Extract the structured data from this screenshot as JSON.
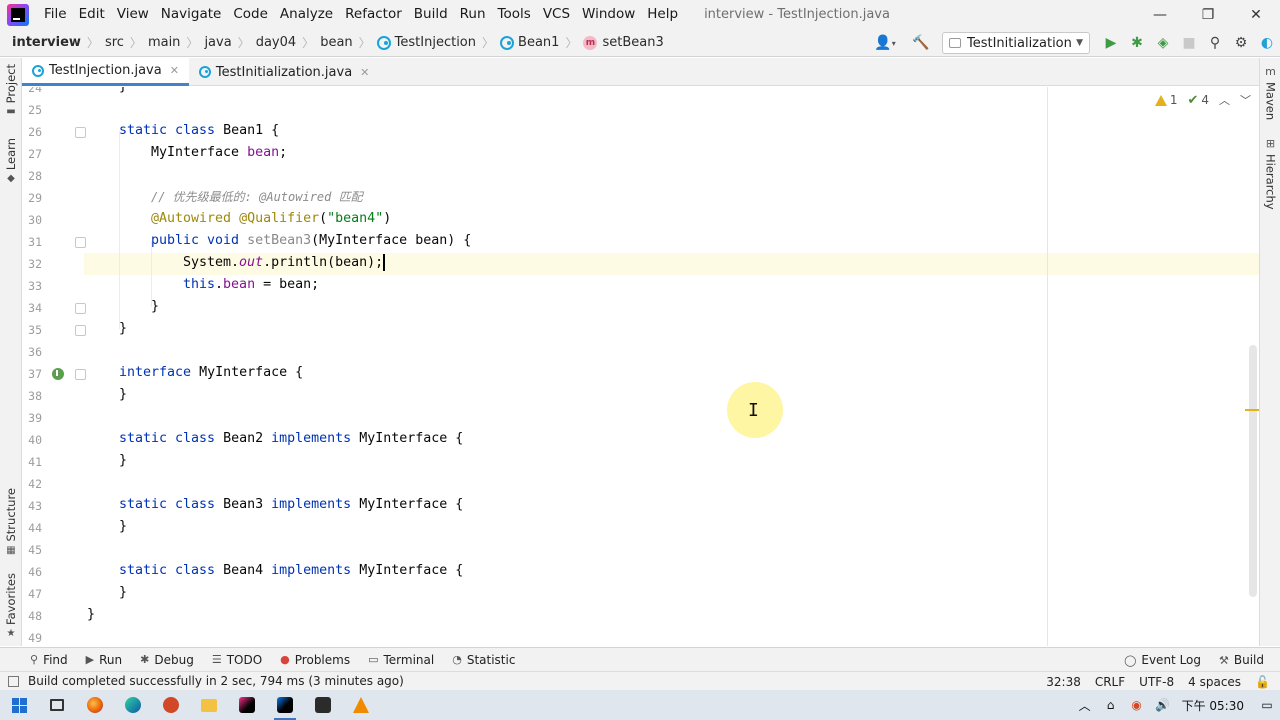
{
  "menu": {
    "items": [
      "File",
      "Edit",
      "View",
      "Navigate",
      "Code",
      "Analyze",
      "Refactor",
      "Build",
      "Run",
      "Tools",
      "VCS",
      "Window",
      "Help"
    ],
    "window_title": "interview - TestInjection.java",
    "controls": [
      "—",
      "❐",
      "✕"
    ]
  },
  "breadcrumb": {
    "project": "interview",
    "parts": [
      "src",
      "main",
      "java",
      "day04",
      "bean"
    ],
    "class1": "TestInjection",
    "class2": "Bean1",
    "method": "setBean3"
  },
  "toolbar": {
    "run_config": "TestInitialization"
  },
  "left_tools": {
    "project": "Project",
    "learn": "Learn",
    "structure": "Structure",
    "favorites": "Favorites"
  },
  "right_tools": {
    "maven": "Maven",
    "hierarchy": "Hierarchy"
  },
  "tabs": [
    {
      "label": "TestInjection.java",
      "active": true
    },
    {
      "label": "TestInitialization.java",
      "active": false
    }
  ],
  "inspections": {
    "warnings": "1",
    "weak_warnings": "4"
  },
  "editor": {
    "line_numbers": [
      "24",
      "25",
      "26",
      "27",
      "28",
      "29",
      "30",
      "31",
      "32",
      "33",
      "34",
      "35",
      "36",
      "37",
      "38",
      "39",
      "40",
      "41",
      "42",
      "43",
      "44",
      "45",
      "46",
      "47",
      "48",
      "49"
    ],
    "code": {
      "l24": "}",
      "l26_kw": "static class ",
      "l26_rest": "Bean1 {",
      "l27_type": "MyInterface ",
      "l27_field": "bean",
      "l27_end": ";",
      "l29_comment": "// 优先级最低的: @Autowired 匹配",
      "l30_ann1": "@Autowired",
      "l30_sp": " ",
      "l30_ann2": "@Qualifier",
      "l30_open": "(",
      "l30_str": "\"bean4\"",
      "l30_close": ")",
      "l31_kw": "public void ",
      "l31_name": "setBean3",
      "l31_rest": "(MyInterface bean) {",
      "l32_a": "System.",
      "l32_out": "out",
      "l32_b": ".println(bean);",
      "l33_kw": "this",
      "l33_dot": ".",
      "l33_field": "bean",
      "l33_rest": " = bean;",
      "l34": "}",
      "l35": "}",
      "l37_kw": "interface ",
      "l37_rest": "MyInterface {",
      "l38": "}",
      "l40_kw": "static class ",
      "l40_name": "Bean2 ",
      "l40_kw2": "implements ",
      "l40_rest": "MyInterface {",
      "l41": "}",
      "l43_kw": "static class ",
      "l43_name": "Bean3 ",
      "l43_kw2": "implements ",
      "l43_rest": "MyInterface {",
      "l44": "}",
      "l46_kw": "static class ",
      "l46_name": "Bean4 ",
      "l46_kw2": "implements ",
      "l46_rest": "MyInterface {",
      "l47": "}",
      "l48": "}"
    }
  },
  "tool_windows": {
    "find": "Find",
    "run": "Run",
    "debug": "Debug",
    "todo": "TODO",
    "problems": "Problems",
    "terminal": "Terminal",
    "statistic": "Statistic",
    "event_log": "Event Log",
    "build": "Build"
  },
  "status": {
    "message": "Build completed successfully in 2 sec, 794 ms (3 minutes ago)",
    "position": "32:38",
    "line_sep": "CRLF",
    "encoding": "UTF-8",
    "indent": "4 spaces"
  },
  "taskbar": {
    "time": "下午 05:30"
  },
  "colors": {
    "keyword": "#0033b3",
    "annotation": "#9e880d",
    "string": "#067d17",
    "field": "#871094",
    "comment": "#8c8c8c",
    "accent": "#4083c9"
  }
}
